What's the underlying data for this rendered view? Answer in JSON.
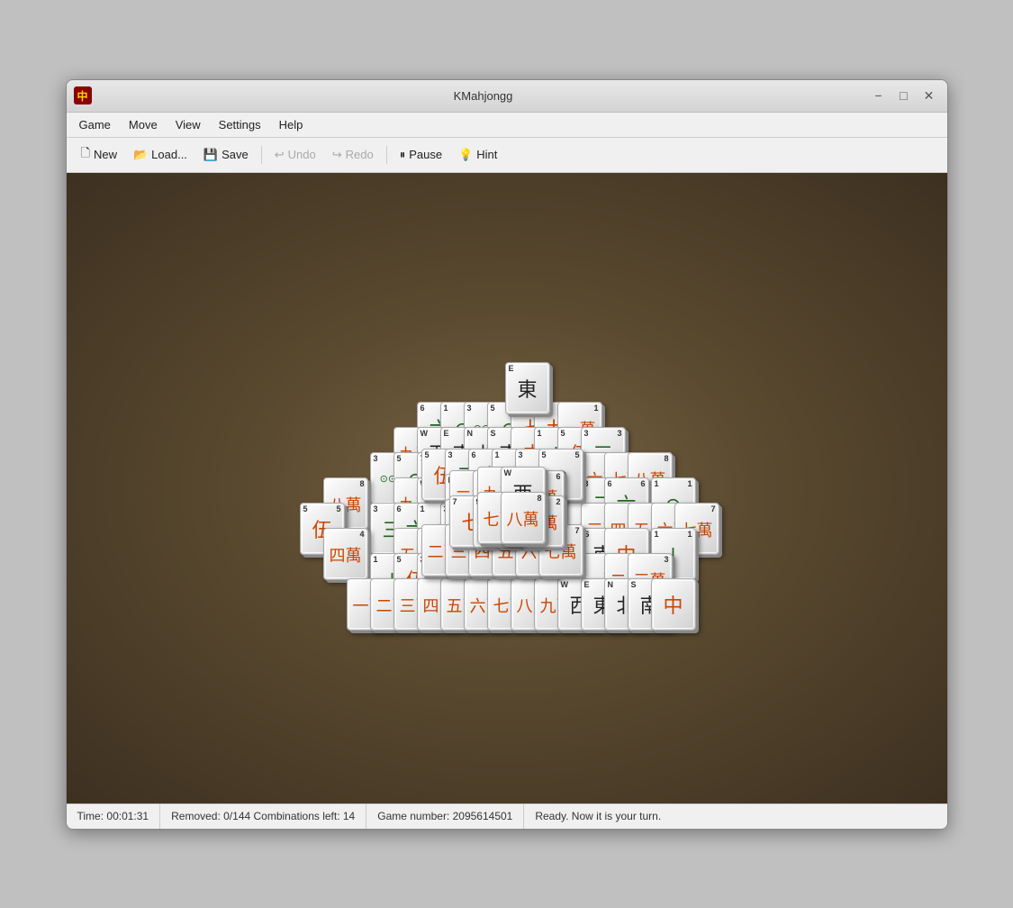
{
  "window": {
    "title": "KMahjongg",
    "icon": "中"
  },
  "titlebar": {
    "minimize_label": "−",
    "maximize_label": "□",
    "close_label": "✕"
  },
  "menubar": {
    "items": [
      {
        "label": "Game",
        "id": "game"
      },
      {
        "label": "Move",
        "id": "move"
      },
      {
        "label": "View",
        "id": "view"
      },
      {
        "label": "Settings",
        "id": "settings"
      },
      {
        "label": "Help",
        "id": "help"
      }
    ]
  },
  "toolbar": {
    "buttons": [
      {
        "label": "New",
        "icon": "📄",
        "id": "new",
        "disabled": false
      },
      {
        "label": "Load...",
        "icon": "📂",
        "id": "load",
        "disabled": false
      },
      {
        "label": "Save",
        "icon": "💾",
        "id": "save",
        "disabled": false
      },
      {
        "label": "Undo",
        "icon": "↩",
        "id": "undo",
        "disabled": true
      },
      {
        "label": "Redo",
        "icon": "↪",
        "id": "redo",
        "disabled": true
      },
      {
        "label": "Pause",
        "icon": "⏸",
        "id": "pause",
        "disabled": false
      },
      {
        "label": "Hint",
        "icon": "💡",
        "id": "hint",
        "disabled": false
      }
    ]
  },
  "statusbar": {
    "time": "Time: 00:01:31",
    "removed": "Removed: 0/144  Combinations left: 14",
    "game_number": "Game number: 2095614501",
    "status": "Ready. Now it is your turn."
  },
  "game": {
    "background_color": "#5a4a30"
  }
}
